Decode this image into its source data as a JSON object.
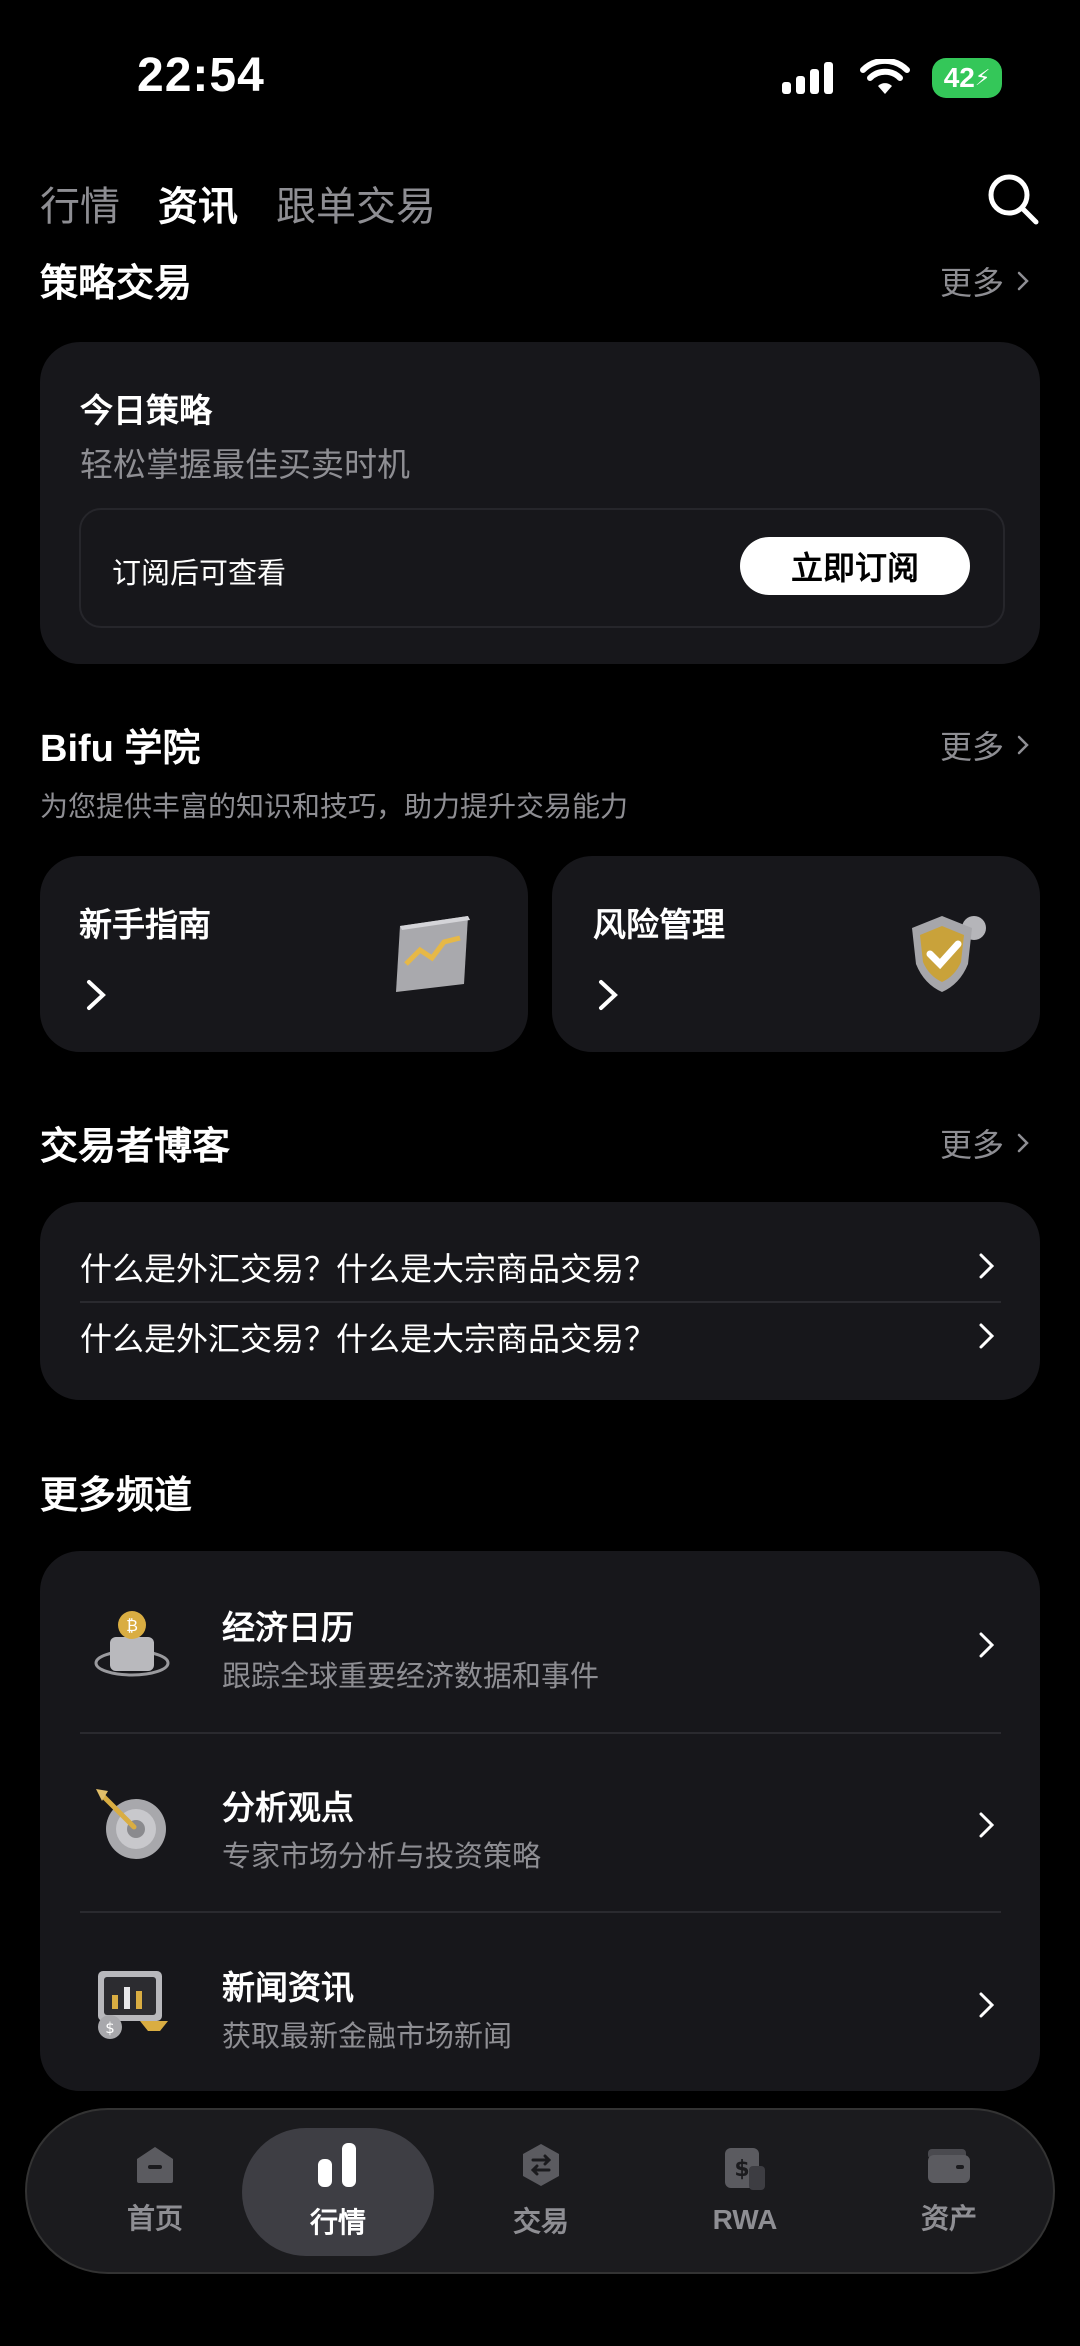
{
  "status_bar": {
    "time": "22:54",
    "battery": "42"
  },
  "top_tabs": [
    {
      "label": "行情",
      "active": false
    },
    {
      "label": "资讯",
      "active": true
    },
    {
      "label": "跟单交易",
      "active": false
    }
  ],
  "strategy": {
    "title": "策略交易",
    "more": "更多",
    "card_title": "今日策略",
    "card_subtitle": "轻松掌握最佳买卖时机",
    "locked_text": "订阅后可查看",
    "subscribe_label": "立即订阅"
  },
  "academy": {
    "title": "Bifu 学院",
    "more": "更多",
    "subtitle": "为您提供丰富的知识和技巧，助力提升交易能力",
    "cards": [
      {
        "label": "新手指南",
        "icon": "chart-board-icon"
      },
      {
        "label": "风险管理",
        "icon": "shield-check-icon"
      }
    ]
  },
  "blog": {
    "title": "交易者博客",
    "more": "更多",
    "items": [
      "什么是外汇交易？什么是大宗商品交易？",
      "什么是外汇交易？什么是大宗商品交易？"
    ]
  },
  "channels": {
    "title": "更多频道",
    "items": [
      {
        "title": "经济日历",
        "subtitle": "跟踪全球重要经济数据和事件",
        "icon": "calendar-coin-icon"
      },
      {
        "title": "分析观点",
        "subtitle": "专家市场分析与投资策略",
        "icon": "target-dart-icon"
      },
      {
        "title": "新闻资讯",
        "subtitle": "获取最新金融市场新闻",
        "icon": "news-board-icon"
      }
    ]
  },
  "bottom_nav": [
    {
      "label": "首页",
      "icon": "home-icon",
      "active": false
    },
    {
      "label": "行情",
      "icon": "market-bars-icon",
      "active": true
    },
    {
      "label": "交易",
      "icon": "exchange-icon",
      "active": false
    },
    {
      "label": "RWA",
      "icon": "dollar-doc-icon",
      "active": false
    },
    {
      "label": "资产",
      "icon": "wallet-icon",
      "active": false
    }
  ],
  "colors": {
    "background": "#000000",
    "card": "#17171b",
    "muted": "#8e8e93",
    "battery": "#34c759"
  }
}
